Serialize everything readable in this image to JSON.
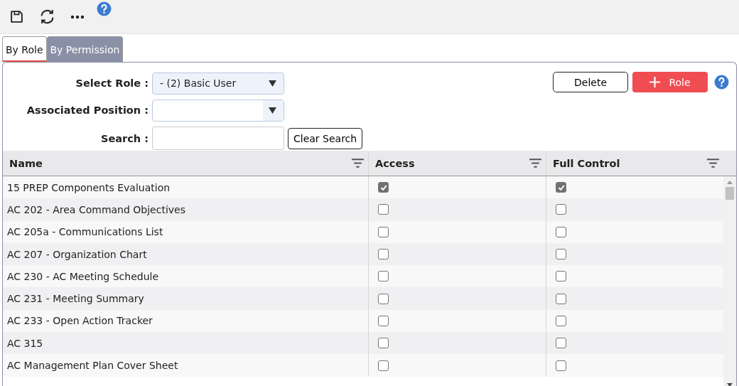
{
  "tabs": [
    {
      "label": "By Role",
      "selected": true
    },
    {
      "label": "By Permission",
      "selected": false
    }
  ],
  "form": {
    "select_role": {
      "label": "Select Role :",
      "value": "- (2) Basic User"
    },
    "associated_position": {
      "label": "Associated Position :"
    },
    "search": {
      "label": "Search :"
    },
    "clear_button": "Clear Search"
  },
  "actions": {
    "delete_button": "Delete",
    "add_button": "Role"
  },
  "table": {
    "columns": [
      "Name",
      "Access",
      "Full Control"
    ],
    "rows": [
      {
        "name": "15 PREP Components Evaluation",
        "access": true,
        "full_control": true
      },
      {
        "name": "AC 202 - Area Command Objectives",
        "access": false,
        "full_control": false
      },
      {
        "name": "AC 205a - Communications List",
        "access": false,
        "full_control": false
      },
      {
        "name": "AC 207 - Organization Chart",
        "access": false,
        "full_control": false
      },
      {
        "name": "AC 230 - AC Meeting Schedule",
        "access": false,
        "full_control": false
      },
      {
        "name": "AC 231 - Meeting Summary",
        "access": false,
        "full_control": false
      },
      {
        "name": "AC 233 - Open Action Tracker",
        "access": false,
        "full_control": false
      },
      {
        "name": "AC 315",
        "access": false,
        "full_control": false
      },
      {
        "name": "AC Management Plan Cover Sheet",
        "access": false,
        "full_control": false
      }
    ]
  }
}
